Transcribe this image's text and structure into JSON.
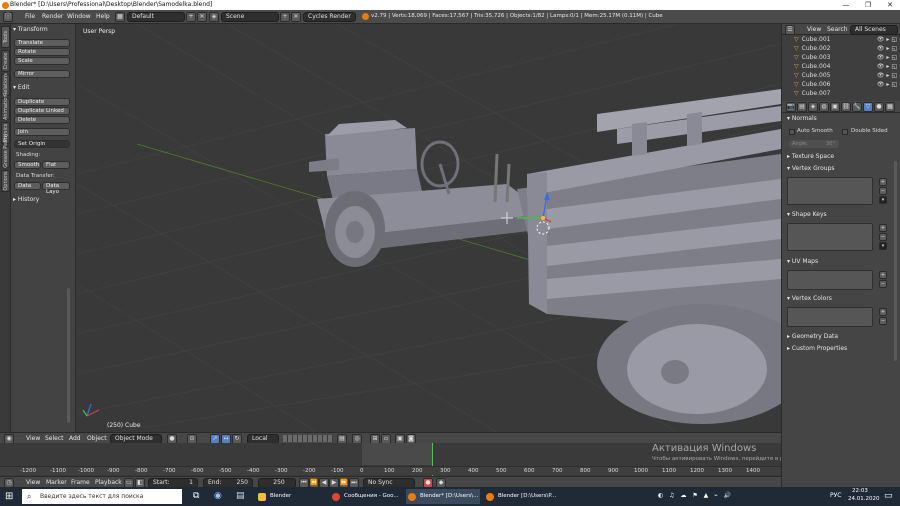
{
  "window": {
    "title": "Blender* [D:\\Users\\Professional\\Desktop\\Blender\\Samodelka.blend]",
    "minimize": "—",
    "maximize": "❐",
    "close": "✕"
  },
  "menubar": {
    "items": [
      "File",
      "Render",
      "Window",
      "Help"
    ],
    "layout": "Default",
    "scene": "Scene",
    "engine": "Cycles Render",
    "stats": "v2.79 | Verts:18,069 | Faces:17,567 | Tris:35,726 | Objects:1/82 | Lamps:0/1 | Mem:25.17M (0.11M) | Cube"
  },
  "tabs": [
    "Tools",
    "Create",
    "Relations",
    "Animation",
    "Physics",
    "Grease Pencil",
    "Options"
  ],
  "toolshelf": {
    "transform_header": "Transform",
    "translate": "Translate",
    "rotate": "Rotate",
    "scale": "Scale",
    "mirror": "Mirror",
    "edit_header": "Edit",
    "duplicate": "Duplicate",
    "duplicate_linked": "Duplicate Linked",
    "delete": "Delete",
    "join": "Join",
    "set_origin": "Set Origin",
    "shading_label": "Shading:",
    "smooth": "Smooth",
    "flat": "Flat",
    "data_transfer_label": "Data Transfer:",
    "data": "Data",
    "data_layers": "Data Layo",
    "history_header": "History"
  },
  "viewport": {
    "label": "User Persp",
    "object_info": "(250) Cube"
  },
  "view_header": {
    "view": "View",
    "select": "Select",
    "add": "Add",
    "object": "Object",
    "mode": "Object Mode",
    "pivot": "Local"
  },
  "timeline": {
    "ticks": [
      "-1200",
      "-1100",
      "-1000",
      "-900",
      "-800",
      "-700",
      "-600",
      "-500",
      "-400",
      "-300",
      "-200",
      "-100",
      "0",
      "100",
      "200",
      "300",
      "400",
      "500",
      "600",
      "700",
      "800",
      "900",
      "1000",
      "1100",
      "1200",
      "1300",
      "1400"
    ],
    "watermark_title": "Активация Windows",
    "watermark_sub": "Чтобы активировать Windows, перейдите в раздел \"Параметры\"."
  },
  "timeline_header": {
    "view": "View",
    "marker": "Marker",
    "frame": "Frame",
    "playback": "Playback",
    "start_label": "Start:",
    "start_value": "1",
    "end_label": "End:",
    "end_value": "250",
    "current": "250",
    "sync": "No Sync"
  },
  "outliner": {
    "view": "View",
    "search": "Search",
    "filter": "All Scenes",
    "items": [
      "Cube.001",
      "Cube.002",
      "Cube.003",
      "Cube.004",
      "Cube.005",
      "Cube.006",
      "Cube.007"
    ]
  },
  "properties": {
    "normals": "Normals",
    "auto_smooth": "Auto Smooth",
    "double_sided": "Double Sided",
    "angle": "Angle:",
    "angle_value": "30°",
    "texture_space": "Texture Space",
    "vertex_groups": "Vertex Groups",
    "shape_keys": "Shape Keys",
    "uv_maps": "UV Maps",
    "vertex_colors": "Vertex Colors",
    "geometry_data": "Geometry Data",
    "custom_properties": "Custom Properties"
  },
  "taskbar": {
    "search_placeholder": "Введите здесь текст для поиска",
    "apps": [
      "Blender",
      "Сообщения - Goo...",
      "Blender* [D:\\Users\\...",
      "Blender [D:\\Users\\P..."
    ],
    "lang": "РУС",
    "time": "22:03",
    "date": "24.01.2020"
  },
  "colors": {
    "accent": "#5680c2",
    "orange": "#e87d0d",
    "taskbar": "#1f2a36"
  }
}
